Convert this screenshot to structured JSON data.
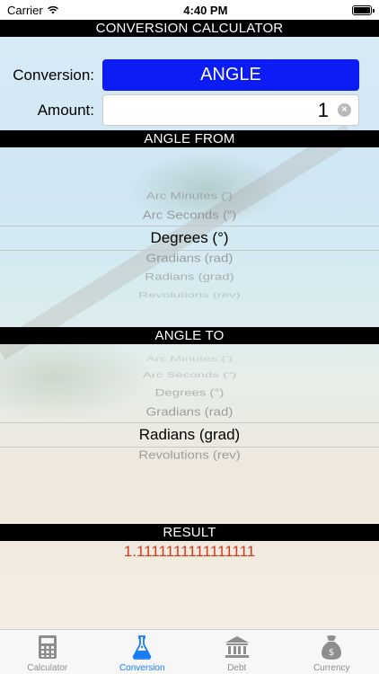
{
  "status_bar": {
    "carrier": "Carrier",
    "time": "4:40 PM"
  },
  "header": {
    "title": "CONVERSION CALCULATOR"
  },
  "form": {
    "conversion_label": "Conversion:",
    "conversion_value": "ANGLE",
    "amount_label": "Amount:",
    "amount_value": "1",
    "clear_symbol": "×"
  },
  "from_picker": {
    "title": "ANGLE FROM",
    "items": [
      "Arc Minutes (')",
      "Arc Seconds (\")",
      "Degrees (°)",
      "Gradians (rad)",
      "Radians (grad)",
      "Revolutions (rev)"
    ],
    "selected_index": 2
  },
  "to_picker": {
    "title": "ANGLE TO",
    "items": [
      "Arc Minutes (')",
      "Arc Seconds (\")",
      "Degrees (°)",
      "Gradians (rad)",
      "Radians (grad)",
      "Revolutions (rev)"
    ],
    "selected_index": 4
  },
  "result": {
    "title": "RESULT",
    "value": "1.1111111111111111"
  },
  "tabs": [
    {
      "label": "Calculator",
      "icon": "calculator-icon",
      "active": false
    },
    {
      "label": "Conversion",
      "icon": "flask-icon",
      "active": true
    },
    {
      "label": "Debt",
      "icon": "bank-icon",
      "active": false
    },
    {
      "label": "Currency",
      "icon": "money-bag-icon",
      "active": false
    }
  ],
  "colors": {
    "accent": "#0b1cf5",
    "header_bg": "#000000",
    "result_text": "#d63a1e",
    "active_tab": "#1a7cf5"
  }
}
